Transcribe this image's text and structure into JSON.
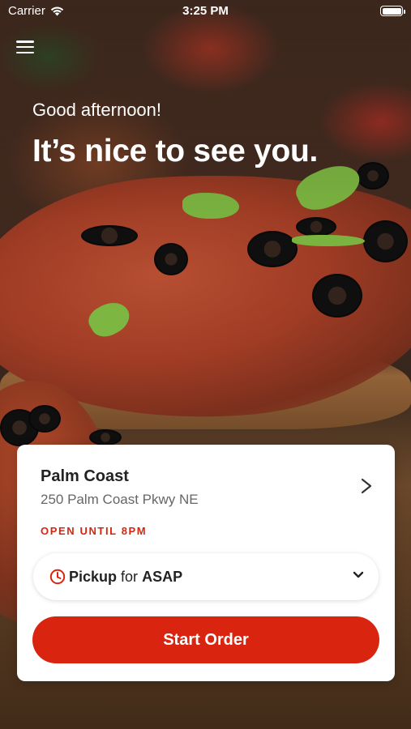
{
  "status_bar": {
    "carrier": "Carrier",
    "time": "3:25 PM"
  },
  "hero": {
    "greeting": "Good afternoon!",
    "headline": "It’s nice to see you."
  },
  "store": {
    "name": "Palm Coast",
    "address": "250 Palm Coast Pkwy NE",
    "hours": "OPEN UNTIL 8PM"
  },
  "fulfillment": {
    "method": "Pickup",
    "connector": "for",
    "time": "ASAP"
  },
  "actions": {
    "start_order_label": "Start Order"
  },
  "colors": {
    "accent": "#d9250f",
    "card_bg": "#ffffff"
  },
  "icons": [
    "wifi-icon",
    "battery-icon",
    "menu-icon",
    "chevron-right-icon",
    "clock-icon",
    "chevron-down-icon"
  ]
}
